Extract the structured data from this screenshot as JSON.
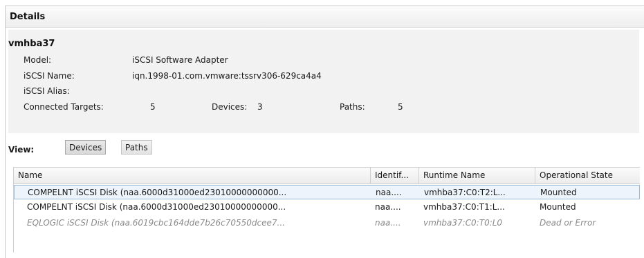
{
  "details": {
    "title": "Details"
  },
  "adapter": {
    "name": "vmhba37",
    "model_label": "Model:",
    "model_value": "iSCSI Software Adapter",
    "iscsi_name_label": "iSCSI Name:",
    "iscsi_name_value": "iqn.1998-01.com.vmware:tssrv306-629ca4a4",
    "iscsi_alias_label": "iSCSI Alias:",
    "iscsi_alias_value": "",
    "connected_targets_label": "Connected Targets:",
    "connected_targets_value": "5",
    "devices_label": "Devices:",
    "devices_value": "3",
    "paths_label": "Paths:",
    "paths_value": "5"
  },
  "view": {
    "label": "View:",
    "devices_button": "Devices",
    "paths_button": "Paths",
    "selected": "Devices"
  },
  "table": {
    "columns": [
      "Name",
      "Identif...",
      "Runtime Name",
      "Operational State"
    ],
    "rows": [
      {
        "name": "COMPELNT iSCSI Disk (naa.6000d31000ed23010000000000...",
        "identifier": "naa....",
        "runtime_name": "vmhba37:C0:T2:L...",
        "operational_state": "Mounted",
        "selected": true,
        "dead": false
      },
      {
        "name": "COMPELNT iSCSI Disk (naa.6000d31000ed23010000000000...",
        "identifier": "naa....",
        "runtime_name": "vmhba37:C0:T1:L...",
        "operational_state": "Mounted",
        "selected": false,
        "dead": false
      },
      {
        "name": "EQLOGIC iSCSI Disk (naa.6019cbc164dde7b26c70550dcee7...",
        "identifier": "naa....",
        "runtime_name": "vmhba37:C0:T0:L0",
        "operational_state": "Dead or Error",
        "selected": false,
        "dead": true
      }
    ]
  }
}
